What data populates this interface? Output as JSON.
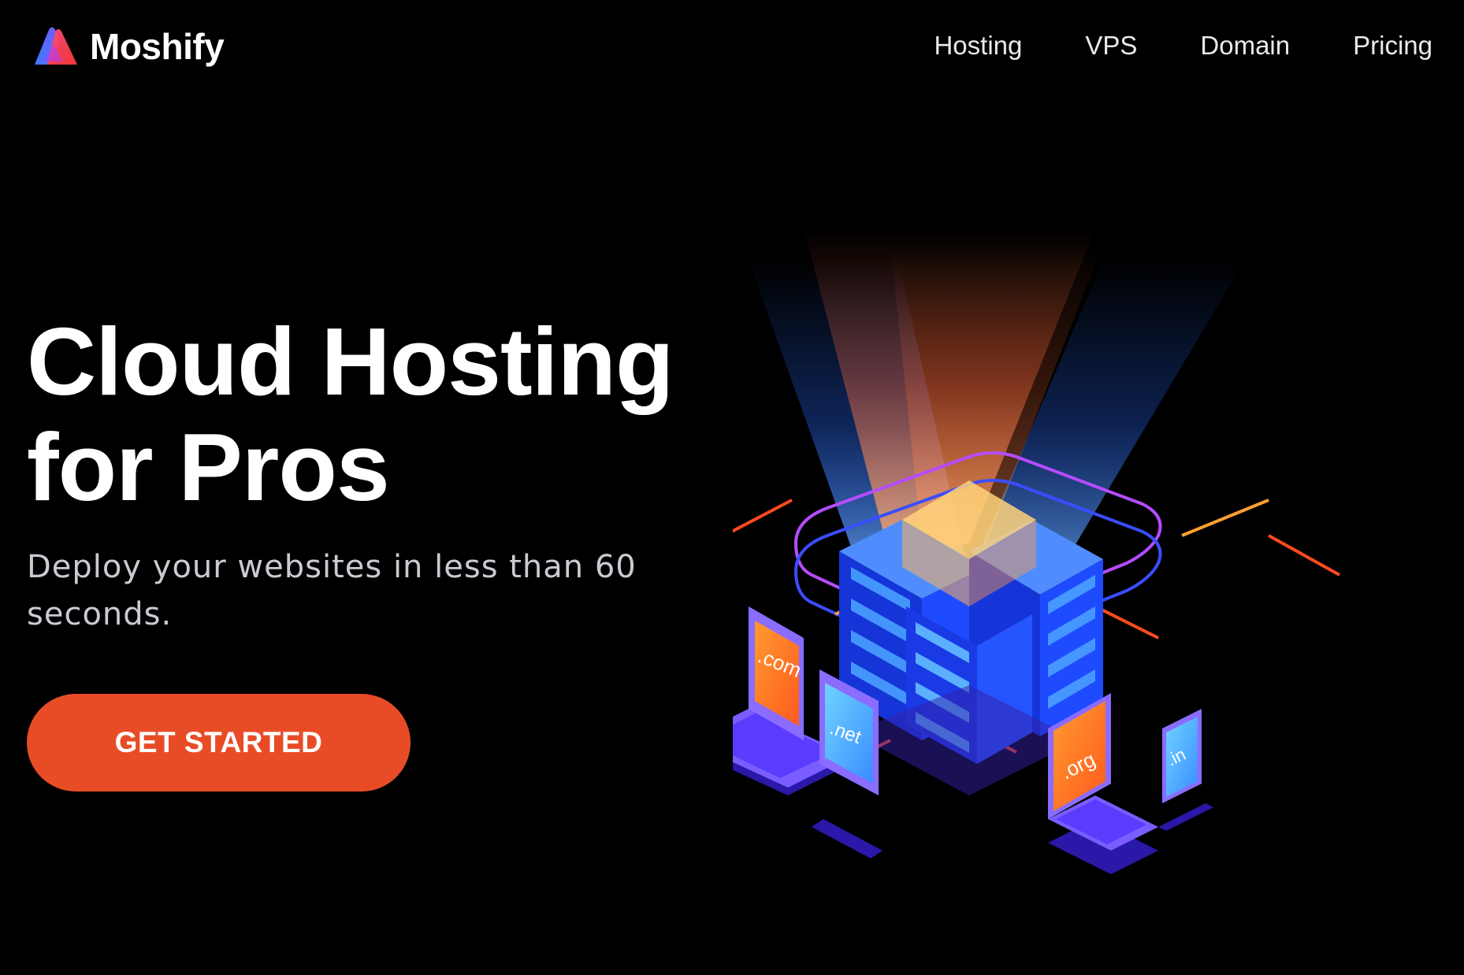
{
  "brand": {
    "name": "Moshify",
    "accent": "#e84c27"
  },
  "nav": {
    "items": [
      {
        "label": "Hosting"
      },
      {
        "label": "VPS"
      },
      {
        "label": "Domain"
      },
      {
        "label": "Pricing"
      }
    ]
  },
  "hero": {
    "title": "Cloud Hosting for Pros",
    "subtitle": "Deploy your websites in less than 60 seconds.",
    "cta_label": "GET STARTED"
  },
  "illustration": {
    "domains": {
      "com": ".com",
      "net": ".net",
      "org": ".org",
      "in": ".in"
    }
  }
}
